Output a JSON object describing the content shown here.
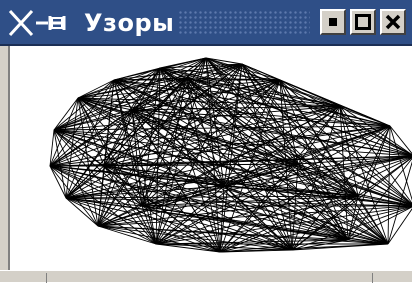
{
  "window": {
    "title": "Узоры"
  },
  "titlebar": {
    "background": "#2f4f87",
    "title_color": "#ffffff",
    "system_menu_icon": "x-window-menu-icon",
    "buttons": [
      {
        "name": "minimize",
        "icon": "minimize-icon"
      },
      {
        "name": "maximize",
        "icon": "maximize-icon"
      },
      {
        "name": "close",
        "icon": "close-icon"
      }
    ]
  },
  "pattern": {
    "stroke_color": "#000000",
    "background": "#ffffff"
  }
}
